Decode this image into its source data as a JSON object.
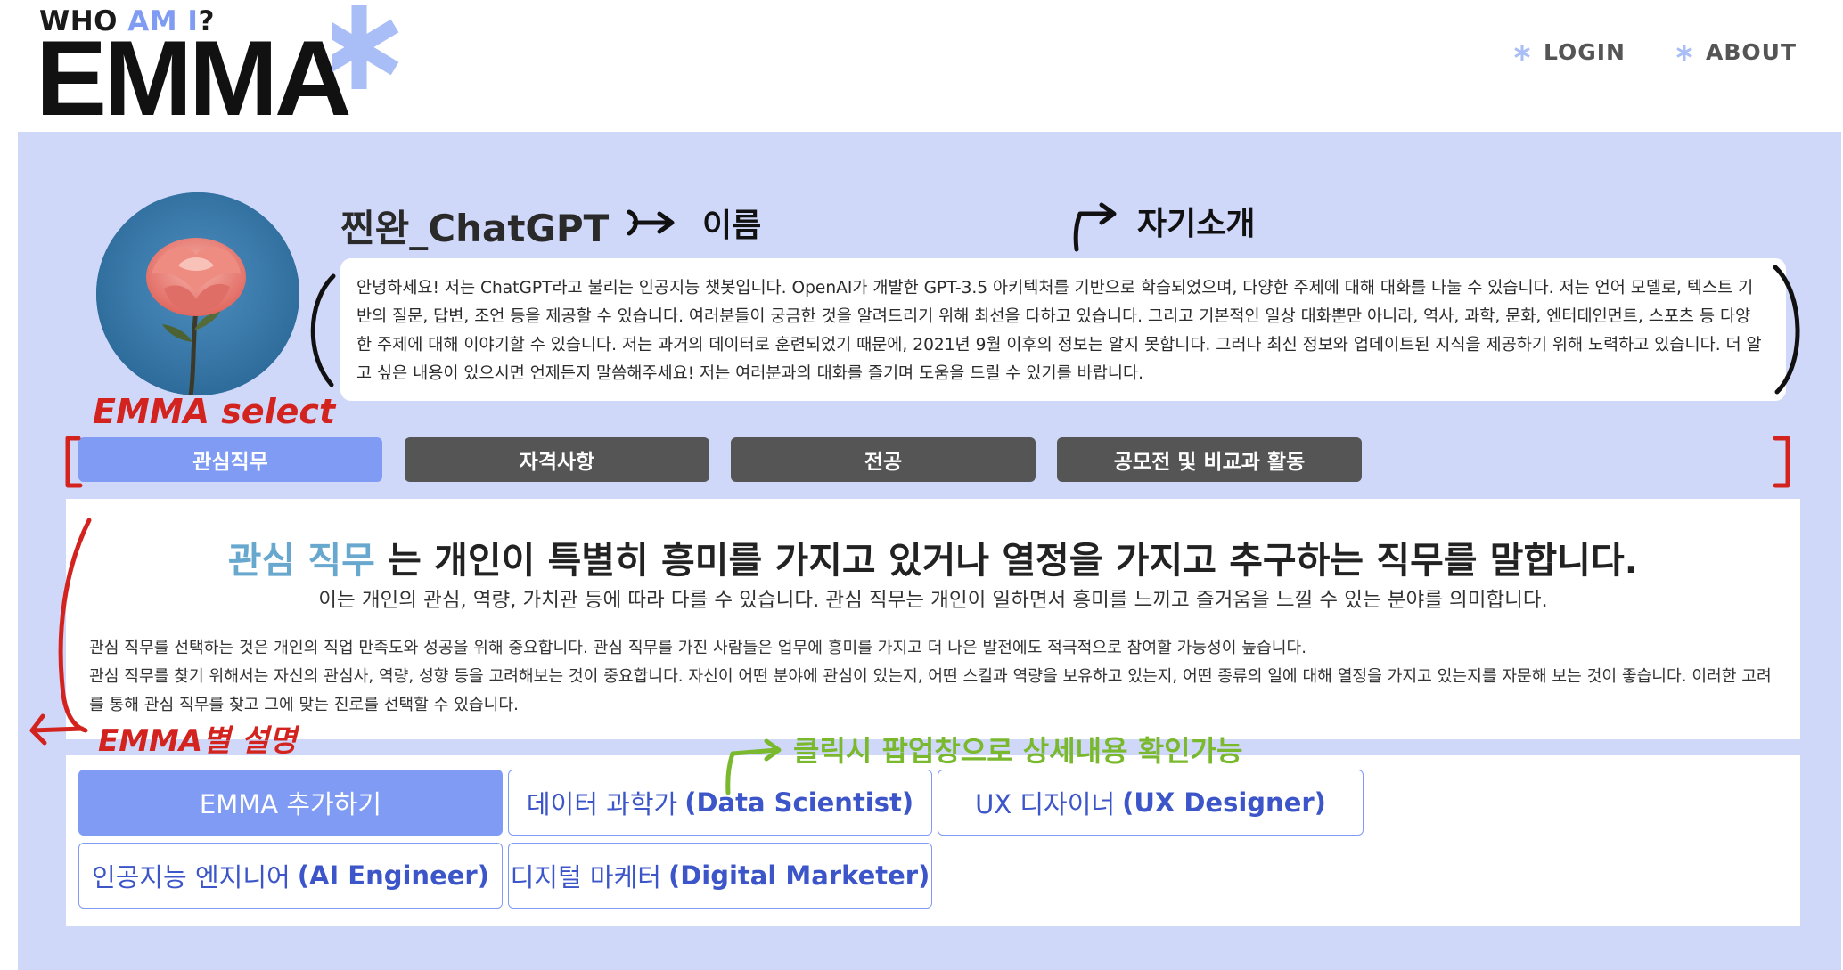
{
  "header": {
    "logo_prefix": "WHO ",
    "logo_highlight": "AM I",
    "logo_suffix": "?",
    "logo_main": "EMMA",
    "nav": [
      {
        "label": "LOGIN"
      },
      {
        "label": "ABOUT"
      }
    ]
  },
  "profile": {
    "name": "찐완_ChatGPT",
    "intro": "안녕하세요! 저는 ChatGPT라고 불리는 인공지능 챗봇입니다. OpenAI가 개발한 GPT-3.5 아키텍처를 기반으로 학습되었으며, 다양한 주제에 대해 대화를 나눌 수 있습니다. 저는 언어 모델로, 텍스트 기반의 질문, 답변, 조언 등을 제공할 수 있습니다. 여러분들이 궁금한 것을 알려드리기 위해 최선을 다하고 있습니다. 그리고 기본적인 일상 대화뿐만 아니라, 역사, 과학, 문화, 엔터테인먼트, 스포츠 등 다양한 주제에 대해 이야기할 수 있습니다. 저는 과거의 데이터로 훈련되었기 때문에, 2021년 9월 이후의 정보는 알지 못합니다. 그러나 최신 정보와 업데이트된 지식을 제공하기 위해 노력하고 있습니다. 더 알고 싶은 내용이 있으시면 언제든지 말씀해주세요! 저는 여러분과의 대화를 즐기며 도움을 드릴 수 있기를 바랍니다."
  },
  "tabs": [
    {
      "label": "관심직무",
      "active": true
    },
    {
      "label": "자격사항",
      "active": false
    },
    {
      "label": "전공",
      "active": false
    },
    {
      "label": "공모전 및 비교과 활동",
      "active": false
    }
  ],
  "description": {
    "headline_highlight": "관심 직무",
    "headline_rest": " 는 개인이 특별히 흥미를 가지고 있거나 열정을 가지고 추구하는 직무를 말합니다.",
    "subline": "이는 개인의 관심, 역량, 가치관 등에 따라 다를 수 있습니다. 관심 직무는 개인이 일하면서 흥미를 느끼고 즐거움을 느낄 수 있는 분야를 의미합니다.",
    "body_1": "관심 직무를 선택하는 것은 개인의 직업 만족도와 성공을 위해 중요합니다. 관심 직무를 가진 사람들은 업무에 흥미를 가지고 더 나은 발전에도 적극적으로 참여할 가능성이 높습니다.",
    "body_2": "관심 직무를 찾기 위해서는 자신의 관심사, 역량, 성향 등을 고려해보는 것이 중요합니다. 자신이 어떤 분야에 관심이 있는지, 어떤 스킬과 역량을 보유하고 있는지, 어떤 종류의 일에 대해 열정을 가지고 있는지를 자문해 보는 것이 좋습니다. 이러한 고려를 통해 관심 직무를 찾고 그에 맞는 진로를 선택할 수 있습니다."
  },
  "jobs": {
    "add_label": "EMMA 추가하기",
    "items": [
      {
        "ko": "데이터 과학가",
        "en": "(Data Scientist)"
      },
      {
        "ko": "UX 디자이너",
        "en": "(UX Designer)"
      },
      {
        "ko": "인공지능 엔지니어",
        "en": "(AI Engineer)"
      },
      {
        "ko": "디지털 마케터",
        "en": "(Digital Marketer)"
      }
    ]
  },
  "annotations": {
    "name_note": "이름",
    "intro_note": "자기소개",
    "select_note": "EMMA select",
    "desc_note": "EMMA별 설명",
    "popup_note": "클릭시 팝업창으로 상세내용 확인가능"
  },
  "colors": {
    "accent": "#7f9bf3",
    "panel_bg": "#d0d8fa",
    "tab_inactive": "#555555",
    "headline_highlight": "#68a8cf",
    "annotation_red": "#d3231f",
    "annotation_green": "#7ab92e"
  }
}
